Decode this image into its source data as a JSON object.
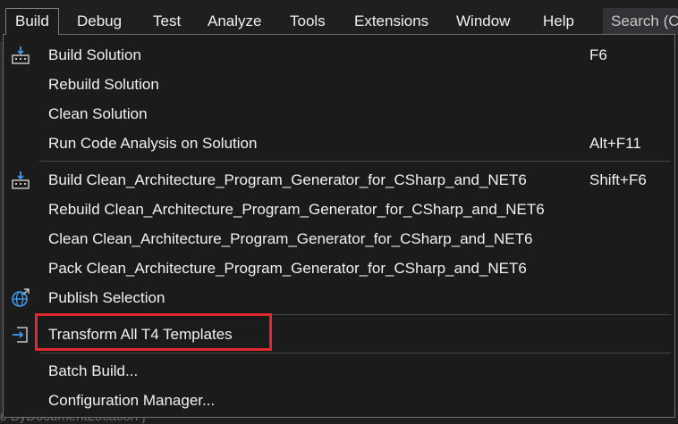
{
  "menubar": {
    "items": [
      "Build",
      "Debug",
      "Test",
      "Analyze",
      "Tools",
      "Extensions",
      "Window",
      "Help"
    ],
    "search_placeholder": "Search (Ct"
  },
  "dropdown": {
    "items": [
      {
        "label": "Build Solution",
        "shortcut": "F6",
        "icon": "build-icon"
      },
      {
        "label": "Rebuild Solution",
        "shortcut": "",
        "icon": ""
      },
      {
        "label": "Clean Solution",
        "shortcut": "",
        "icon": ""
      },
      {
        "label": "Run Code Analysis on Solution",
        "shortcut": "Alt+F11",
        "icon": ""
      },
      {
        "label": "Build Clean_Architecture_Program_Generator_for_CSharp_and_NET6",
        "shortcut": "Shift+F6",
        "icon": "build-icon"
      },
      {
        "label": "Rebuild Clean_Architecture_Program_Generator_for_CSharp_and_NET6",
        "shortcut": "",
        "icon": ""
      },
      {
        "label": "Clean Clean_Architecture_Program_Generator_for_CSharp_and_NET6",
        "shortcut": "",
        "icon": ""
      },
      {
        "label": "Pack Clean_Architecture_Program_Generator_for_CSharp_and_NET6",
        "shortcut": "",
        "icon": ""
      },
      {
        "label": "Publish Selection",
        "shortcut": "",
        "icon": "globe-icon"
      },
      {
        "label": "Transform All T4 Templates",
        "shortcut": "",
        "icon": "transform-icon"
      },
      {
        "label": "Batch Build...",
        "shortcut": "",
        "icon": ""
      },
      {
        "label": "Configuration Manager...",
        "shortcut": "",
        "icon": ""
      }
    ]
  },
  "background": {
    "partial_text": "c  ByDocumentLocation  }"
  },
  "colors": {
    "accent_highlight": "#e0282e",
    "menu_bg": "#1b1b1c",
    "text": "#f1f1f1"
  }
}
